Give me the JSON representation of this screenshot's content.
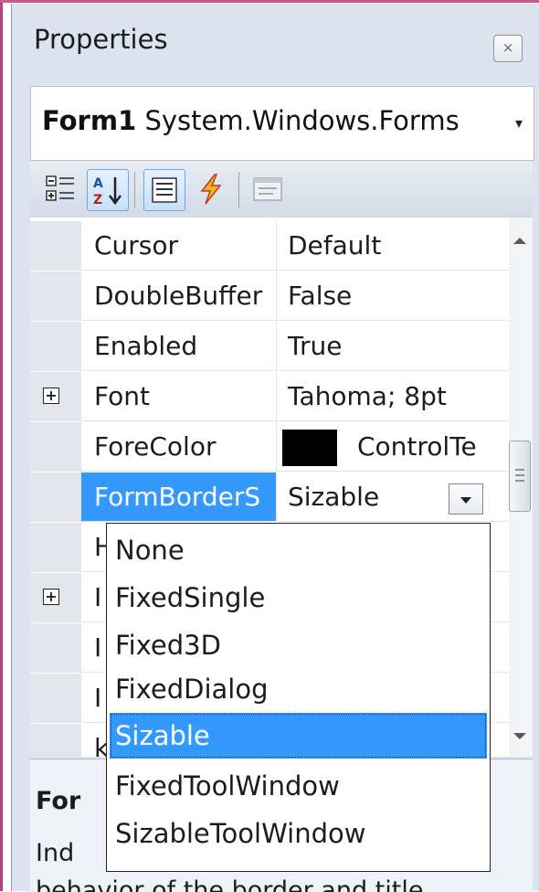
{
  "panel": {
    "title": "Properties",
    "close_icon": "×"
  },
  "object_selector": {
    "name": "Form1",
    "type": "System.Windows.Forms",
    "dropdown_icon": "▾"
  },
  "toolbar": {
    "buttons": [
      "categorized-icon",
      "alphabetical-icon",
      "properties-icon",
      "events-icon",
      "property-pages-icon"
    ]
  },
  "grid": {
    "rows": [
      {
        "name": "Cursor",
        "value": "Default"
      },
      {
        "name": "DoubleBuffer",
        "value": "False"
      },
      {
        "name": "Enabled",
        "value": "True"
      },
      {
        "name": "Font",
        "value": "Tahoma; 8pt",
        "expandable": true
      },
      {
        "name": "ForeColor",
        "value": "ControlTe",
        "swatch": "#000000"
      },
      {
        "name": "FormBorderS",
        "value": "Sizable",
        "selected": true
      },
      {
        "name": "H",
        "value": ""
      },
      {
        "name": "I",
        "value": "",
        "expandable": true
      },
      {
        "name": "I",
        "value": ""
      },
      {
        "name": "I",
        "value": ""
      },
      {
        "name": "k",
        "value": ""
      }
    ]
  },
  "dropdown": {
    "options": [
      "None",
      "FixedSingle",
      "Fixed3D",
      "FixedDialog",
      "Sizable",
      "FixedToolWindow",
      "SizableToolWindow"
    ],
    "selected": "Sizable"
  },
  "description": {
    "title": "For",
    "text_line1": "Ind",
    "text_line2": "behavior of the border and title ..."
  },
  "colors": {
    "selection": "#3399ff",
    "panel_bg": "#dde3ee",
    "frame": "#c95a8c"
  }
}
